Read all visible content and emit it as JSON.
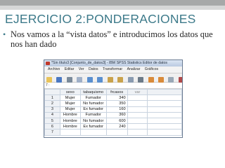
{
  "slide": {
    "title": "EJERCICIO 2:PONDERACIONES",
    "bullet": "Nos vamos a la “vista datos” e introducimos los datos que nos han dado",
    "bullet_symbol": "•"
  },
  "spss": {
    "window_title": "*Sin título3 [Conjunto_de_datos3] - IBM SPSS Statistics Editor de datos",
    "menu": [
      "Archivo",
      "Editar",
      "Ver",
      "Datos",
      "Transformar",
      "Analizar",
      "Gráficos"
    ],
    "cell_ref": "7 :",
    "columns": [
      "",
      "sexo",
      "tabaquismo",
      "frcasos",
      "var"
    ],
    "rows": [
      [
        "1",
        "Mujer",
        "Fumador",
        "340"
      ],
      [
        "2",
        "Mujer",
        "No fumador",
        "350"
      ],
      [
        "3",
        "Mujer",
        "Ex fumador",
        "160"
      ],
      [
        "4",
        "Hombre",
        "Fumador",
        "360"
      ],
      [
        "5",
        "Hombre",
        "No fumador",
        "600"
      ],
      [
        "6",
        "Hombre",
        "Ex fumador",
        "240"
      ],
      [
        "7",
        "",
        "",
        ""
      ]
    ],
    "toolbar_icons": [
      "open-icon",
      "save-icon",
      "print-icon",
      "dialog-recall-icon",
      "undo-icon",
      "redo-icon",
      "goto-case-icon",
      "goto-variable-icon",
      "variables-icon",
      "find-icon",
      "insert-cases-icon",
      "insert-variable-icon",
      "split-file-icon",
      "weight-cases-icon",
      "select-cases-icon"
    ]
  }
}
